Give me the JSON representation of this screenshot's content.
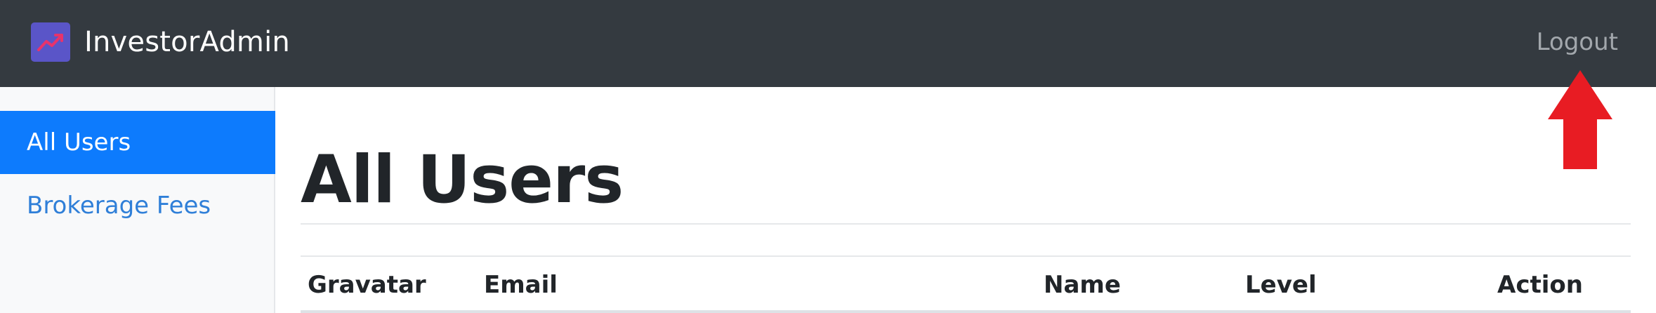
{
  "app": {
    "brand_name": "InvestorAdmin",
    "logo_icon": "trending-up-chart-icon",
    "logout_label": "Logout"
  },
  "sidebar": {
    "items": [
      {
        "label": "All Users",
        "active": true
      },
      {
        "label": "Brokerage Fees",
        "active": false
      }
    ]
  },
  "main": {
    "title": "All Users",
    "table": {
      "columns": [
        "Gravatar",
        "Email",
        "Name",
        "Level",
        "Action"
      ]
    }
  },
  "annotation": {
    "icon": "red-up-arrow-icon",
    "color": "#e81c23"
  },
  "colors": {
    "navbar": "#343a40",
    "active_nav": "#0d7bfd",
    "link": "#2f7fd8"
  }
}
